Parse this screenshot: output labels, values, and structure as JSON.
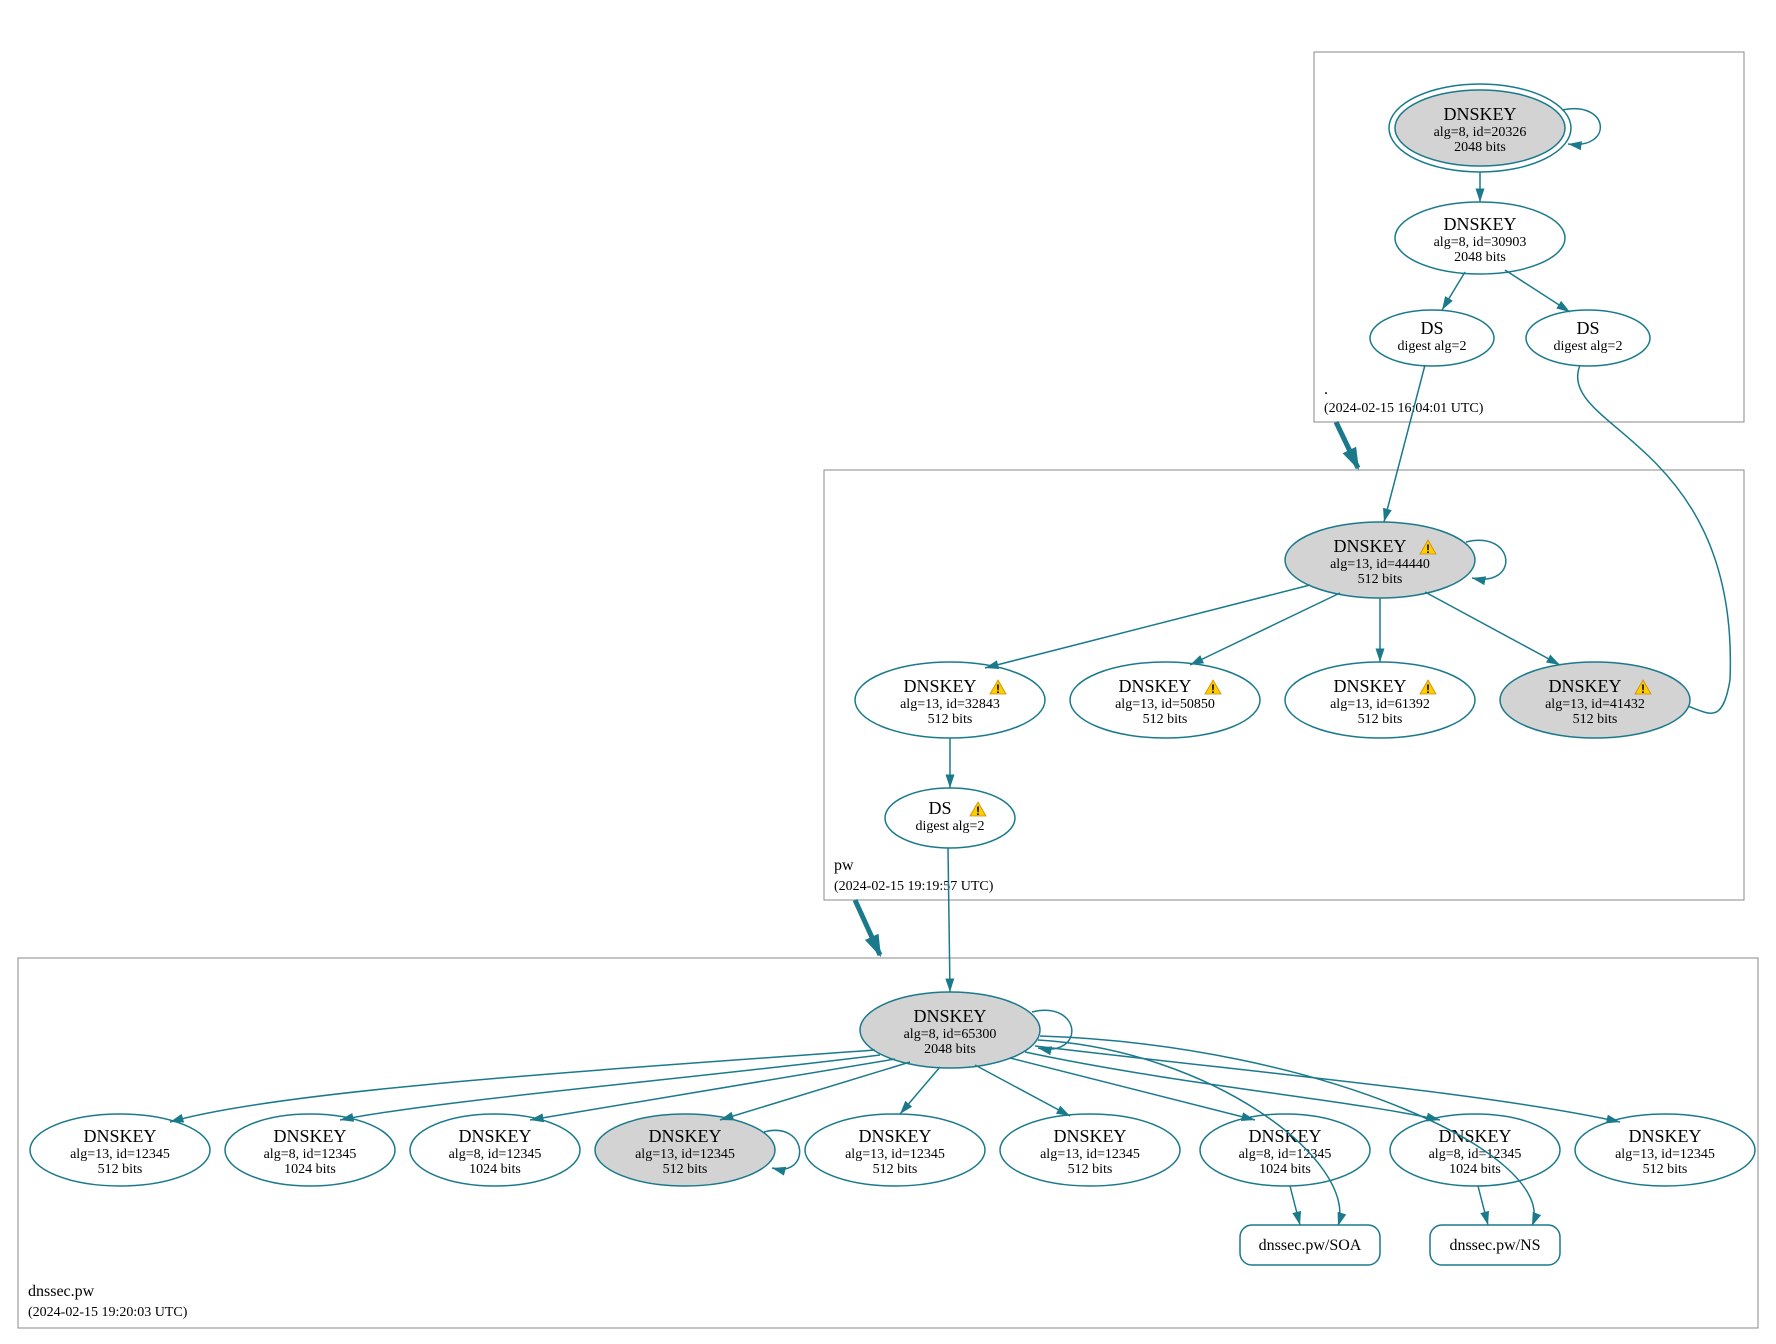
{
  "zones": {
    "root": {
      "name": ".",
      "time": "(2024-02-15 16:04:01 UTC)"
    },
    "pw": {
      "name": "pw",
      "time": "(2024-02-15 19:19:57 UTC)"
    },
    "dnssec_pw": {
      "name": "dnssec.pw",
      "time": "(2024-02-15 19:20:03 UTC)"
    }
  },
  "nodes": {
    "root_ksk": {
      "title": "DNSKEY",
      "line1": "alg=8, id=20326",
      "line2": "2048 bits"
    },
    "root_zsk": {
      "title": "DNSKEY",
      "line1": "alg=8, id=30903",
      "line2": "2048 bits"
    },
    "root_ds1": {
      "title": "DS",
      "line1": "digest alg=2"
    },
    "root_ds2": {
      "title": "DS",
      "line1": "digest alg=2"
    },
    "pw_ksk": {
      "title": "DNSKEY",
      "line1": "alg=13, id=44440",
      "line2": "512 bits"
    },
    "pw_z1": {
      "title": "DNSKEY",
      "line1": "alg=13, id=32843",
      "line2": "512 bits"
    },
    "pw_z2": {
      "title": "DNSKEY",
      "line1": "alg=13, id=50850",
      "line2": "512 bits"
    },
    "pw_z3": {
      "title": "DNSKEY",
      "line1": "alg=13, id=61392",
      "line2": "512 bits"
    },
    "pw_z4": {
      "title": "DNSKEY",
      "line1": "alg=13, id=41432",
      "line2": "512 bits"
    },
    "pw_ds": {
      "title": "DS",
      "line1": "digest alg=2"
    },
    "d_ksk": {
      "title": "DNSKEY",
      "line1": "alg=8, id=65300",
      "line2": "2048 bits"
    },
    "d_k1": {
      "title": "DNSKEY",
      "line1": "alg=13, id=12345",
      "line2": "512 bits"
    },
    "d_k2": {
      "title": "DNSKEY",
      "line1": "alg=8, id=12345",
      "line2": "1024 bits"
    },
    "d_k3": {
      "title": "DNSKEY",
      "line1": "alg=8, id=12345",
      "line2": "1024 bits"
    },
    "d_k4": {
      "title": "DNSKEY",
      "line1": "alg=13, id=12345",
      "line2": "512 bits"
    },
    "d_k5": {
      "title": "DNSKEY",
      "line1": "alg=13, id=12345",
      "line2": "512 bits"
    },
    "d_k6": {
      "title": "DNSKEY",
      "line1": "alg=13, id=12345",
      "line2": "512 bits"
    },
    "d_k7": {
      "title": "DNSKEY",
      "line1": "alg=8, id=12345",
      "line2": "1024 bits"
    },
    "d_k8": {
      "title": "DNSKEY",
      "line1": "alg=8, id=12345",
      "line2": "1024 bits"
    },
    "d_k9": {
      "title": "DNSKEY",
      "line1": "alg=13, id=12345",
      "line2": "512 bits"
    },
    "soa": {
      "title": "dnssec.pw/SOA"
    },
    "ns": {
      "title": "dnssec.pw/NS"
    }
  },
  "colors": {
    "stroke": "#1a7a8c",
    "grey": "#d3d3d3"
  }
}
